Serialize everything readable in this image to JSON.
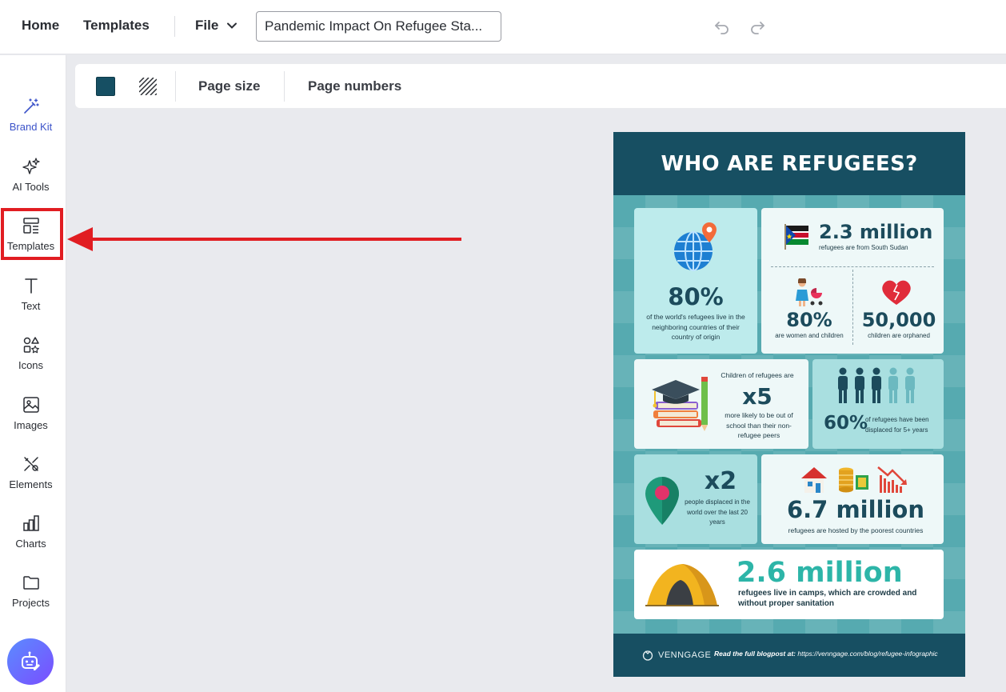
{
  "topbar": {
    "home": "Home",
    "templates": "Templates",
    "file": "File",
    "document_title": "Pandemic Impact On Refugee Sta..."
  },
  "sidebar": {
    "items": [
      {
        "label": "Brand Kit",
        "icon": "magic-wand-icon"
      },
      {
        "label": "AI Tools",
        "icon": "sparkles-icon"
      },
      {
        "label": "Templates",
        "icon": "templates-icon"
      },
      {
        "label": "Text",
        "icon": "text-icon"
      },
      {
        "label": "Icons",
        "icon": "shapes-icon"
      },
      {
        "label": "Images",
        "icon": "image-icon"
      },
      {
        "label": "Elements",
        "icon": "elements-icon"
      },
      {
        "label": "Charts",
        "icon": "bar-chart-icon"
      },
      {
        "label": "Projects",
        "icon": "folder-icon"
      }
    ],
    "highlighted": "Templates"
  },
  "toolbar": {
    "background_color": "#164f63",
    "page_size": "Page size",
    "page_numbers": "Page numbers"
  },
  "infographic": {
    "title": "WHO ARE REFUGEES?",
    "stat1_value": "80%",
    "stat1_text": "of the world's refugees live in the neighboring countries of their country of origin",
    "stat2_value": "2.3 million",
    "stat2_text": "refugees are from South Sudan",
    "stat3_value": "80%",
    "stat3_text": "are women and children",
    "stat4_value": "50,000",
    "stat4_text": "children are orphaned",
    "stat5_intro": "Children of refugees are",
    "stat5_value": "x5",
    "stat5_text": "more likely to be out of school than their non-refugee peers",
    "stat6_value": "60%",
    "stat6_text": "of refugees have been displaced for 5+ years",
    "stat7_value": "x2",
    "stat7_text": "people displaced in the world over the last 20 years",
    "stat8_value": "6.7 million",
    "stat8_text": "refugees are hosted by the poorest countries",
    "stat9_value": "2.6 million",
    "stat9_text": "refugees live in camps, which are crowded and without proper sanitation",
    "footer_brand": "VENNGAGE",
    "footer_prefix": "Read the full blogpost at:",
    "footer_url": "https://venngage.com/blog/refugee-infographic"
  },
  "colors": {
    "accent": "#3c53c9",
    "highlight": "#e11d22",
    "infographic_dark": "#174f62",
    "infographic_teal": "#2db5a8"
  }
}
